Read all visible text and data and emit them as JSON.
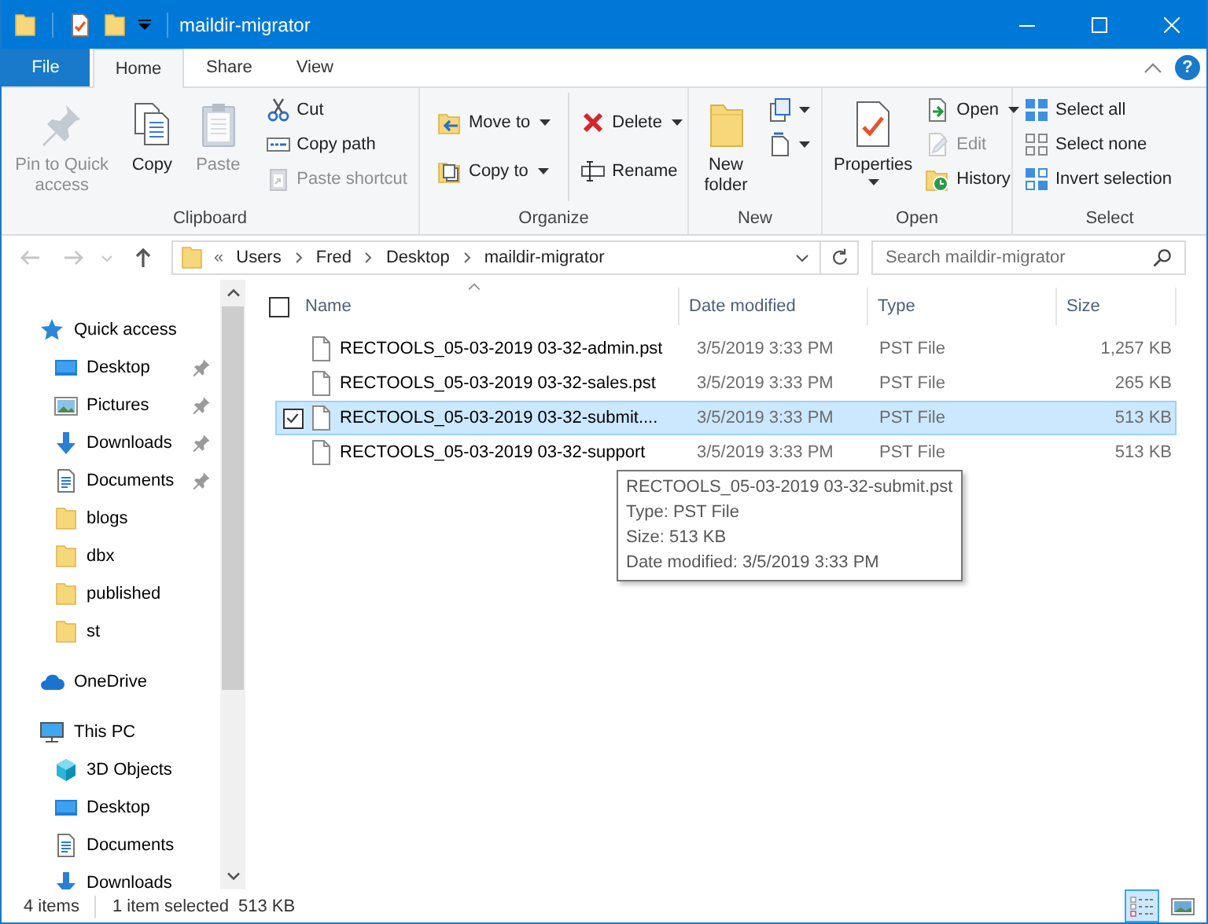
{
  "window": {
    "title": "maildir-migrator"
  },
  "ribbon_tabs": [
    {
      "label": "File",
      "kind": "file",
      "selected": false
    },
    {
      "label": "Home",
      "kind": "tab",
      "selected": true
    },
    {
      "label": "Share",
      "kind": "tab",
      "selected": false
    },
    {
      "label": "View",
      "kind": "tab",
      "selected": false
    }
  ],
  "help": "?",
  "ribbon_groups": [
    {
      "label": "Clipboard",
      "columns": [
        [
          {
            "kind": "large",
            "label": "Pin to Quick access",
            "disabled": true,
            "dropdown": false
          }
        ],
        [
          {
            "kind": "large",
            "label": "Copy",
            "disabled": false,
            "dropdown": false
          }
        ],
        [
          {
            "kind": "large",
            "label": "Paste",
            "disabled": true,
            "dropdown": false
          }
        ],
        [
          {
            "kind": "small",
            "label": "Cut",
            "disabled": false,
            "dropdown": false
          },
          {
            "kind": "small",
            "label": "Copy path",
            "disabled": false,
            "dropdown": false
          },
          {
            "kind": "small",
            "label": "Paste shortcut",
            "disabled": true,
            "dropdown": false
          }
        ]
      ]
    },
    {
      "label": "Organize",
      "columns": [
        [
          {
            "kind": "small",
            "label": "Move to",
            "disabled": false,
            "dropdown": true
          },
          {
            "kind": "small",
            "label": "Copy to",
            "disabled": false,
            "dropdown": true
          }
        ],
        [
          {
            "kind": "small",
            "label": "Delete",
            "disabled": false,
            "dropdown": true
          },
          {
            "kind": "small",
            "label": "Rename",
            "disabled": false,
            "dropdown": false
          }
        ]
      ]
    },
    {
      "label": "New",
      "columns": [
        [
          {
            "kind": "large",
            "label": "New folder",
            "disabled": false,
            "dropdown": false
          }
        ],
        [
          {
            "kind": "icon",
            "disabled": false,
            "dropdown": true
          },
          {
            "kind": "icon",
            "disabled": false,
            "dropdown": true
          }
        ]
      ]
    },
    {
      "label": "Open",
      "columns": [
        [
          {
            "kind": "large",
            "label": "Properties",
            "disabled": false,
            "dropdown": true
          }
        ],
        [
          {
            "kind": "small",
            "label": "Open",
            "disabled": false,
            "dropdown": true
          },
          {
            "kind": "small",
            "label": "Edit",
            "disabled": true,
            "dropdown": false
          },
          {
            "kind": "small",
            "label": "History",
            "disabled": false,
            "dropdown": false
          }
        ]
      ]
    },
    {
      "label": "Select",
      "columns": [
        [
          {
            "kind": "small",
            "label": "Select all",
            "disabled": false,
            "dropdown": false
          },
          {
            "kind": "small",
            "label": "Select none",
            "disabled": false,
            "dropdown": false
          },
          {
            "kind": "small",
            "label": "Invert selection",
            "disabled": false,
            "dropdown": false
          }
        ]
      ]
    }
  ],
  "address_bar": {
    "overflow": "«",
    "path": [
      "Users",
      "Fred",
      "Desktop",
      "maildir-migrator"
    ]
  },
  "search": {
    "placeholder": "Search maildir-migrator"
  },
  "navigation": [
    {
      "label": "Quick access",
      "children": [
        {
          "label": "Desktop",
          "pinned": true
        },
        {
          "label": "Pictures",
          "pinned": true
        },
        {
          "label": "Downloads",
          "pinned": true
        },
        {
          "label": "Documents",
          "pinned": true
        },
        {
          "label": "blogs",
          "pinned": false
        },
        {
          "label": "dbx",
          "pinned": false
        },
        {
          "label": "published",
          "pinned": false
        },
        {
          "label": "st",
          "pinned": false
        }
      ]
    },
    {
      "label": "OneDrive"
    },
    {
      "label": "This PC",
      "children": [
        {
          "label": "3D Objects",
          "pinned": false
        },
        {
          "label": "Desktop",
          "pinned": false
        },
        {
          "label": "Documents",
          "pinned": false
        },
        {
          "label": "Downloads",
          "pinned": false
        }
      ]
    }
  ],
  "file_list": {
    "header_checkbox": {
      "checked": false
    },
    "columns": [
      "Name",
      "Date modified",
      "Type",
      "Size"
    ],
    "rows": [
      {
        "name": "RECTOOLS_05-03-2019 03-32-admin.pst",
        "date_modified": "3/5/2019 3:33 PM",
        "type": "PST File",
        "size": "1,257 KB",
        "selected": false,
        "checked": false
      },
      {
        "name": "RECTOOLS_05-03-2019 03-32-sales.pst",
        "date_modified": "3/5/2019 3:33 PM",
        "type": "PST File",
        "size": "265 KB",
        "selected": false,
        "checked": false
      },
      {
        "name": "RECTOOLS_05-03-2019 03-32-submit....",
        "date_modified": "3/5/2019 3:33 PM",
        "type": "PST File",
        "size": "513 KB",
        "selected": true,
        "checked": true
      },
      {
        "name": "RECTOOLS_05-03-2019 03-32-support",
        "date_modified": "3/5/2019 3:33 PM",
        "type": "PST File",
        "size": "513 KB",
        "selected": false,
        "checked": false
      }
    ]
  },
  "tooltip": {
    "lines": [
      "RECTOOLS_05-03-2019 03-32-submit.pst",
      "Type: PST File",
      "Size: 513 KB",
      "Date modified: 3/5/2019 3:33 PM"
    ]
  },
  "status_bar": {
    "item_count": "4 items",
    "selection": "1 item selected",
    "selection_size": "513 KB",
    "views": [
      {
        "kind": "details",
        "selected": true
      },
      {
        "kind": "large_icons",
        "selected": false
      }
    ]
  }
}
